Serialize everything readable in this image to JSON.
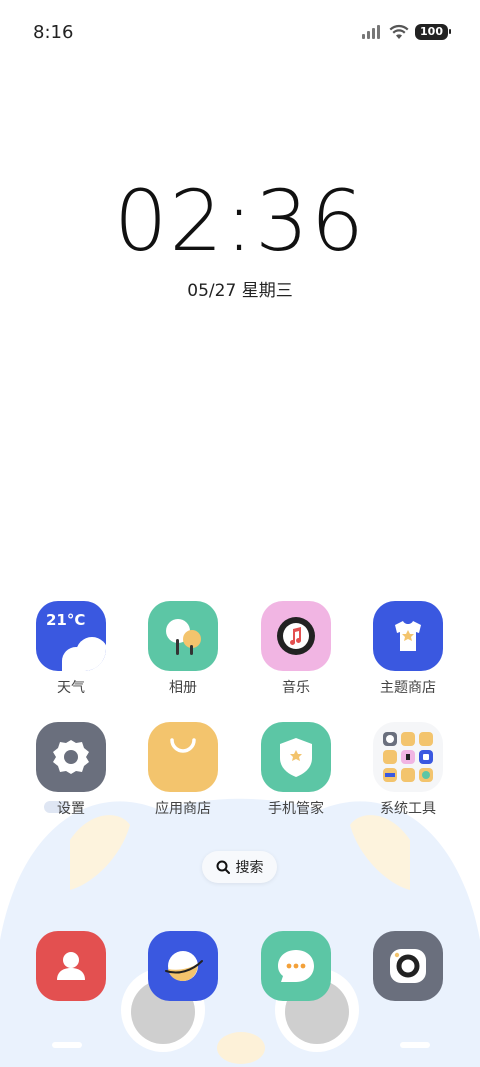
{
  "status_bar": {
    "time": "8:16",
    "battery": "100"
  },
  "lock_clock": {
    "time": "02:36",
    "date": "05/27 星期三"
  },
  "apps": [
    {
      "label": "天气",
      "icon": "weather-icon",
      "badge_text": "21°C",
      "color": "#3a58e0"
    },
    {
      "label": "相册",
      "icon": "gallery-icon",
      "color": "#5cc6a5"
    },
    {
      "label": "音乐",
      "icon": "music-icon",
      "color": "#f1b5e3"
    },
    {
      "label": "主题商店",
      "icon": "theme-store-icon",
      "color": "#3a58e0"
    },
    {
      "label": "设置",
      "icon": "settings-icon",
      "color": "#6a6f7d"
    },
    {
      "label": "应用商店",
      "icon": "app-store-icon",
      "color": "#f3c46d"
    },
    {
      "label": "手机管家",
      "icon": "phone-manager-icon",
      "color": "#5cc6a5"
    },
    {
      "label": "系统工具",
      "icon": "folder-icon",
      "color": "#f5f6f8"
    }
  ],
  "search": {
    "label": "搜索"
  },
  "dock": [
    {
      "icon": "contacts-icon",
      "color": "#e35050"
    },
    {
      "icon": "browser-icon",
      "color": "#3a58e0"
    },
    {
      "icon": "messages-icon",
      "color": "#5cc6a5"
    },
    {
      "icon": "camera-icon",
      "color": "#6a6f7d"
    }
  ]
}
